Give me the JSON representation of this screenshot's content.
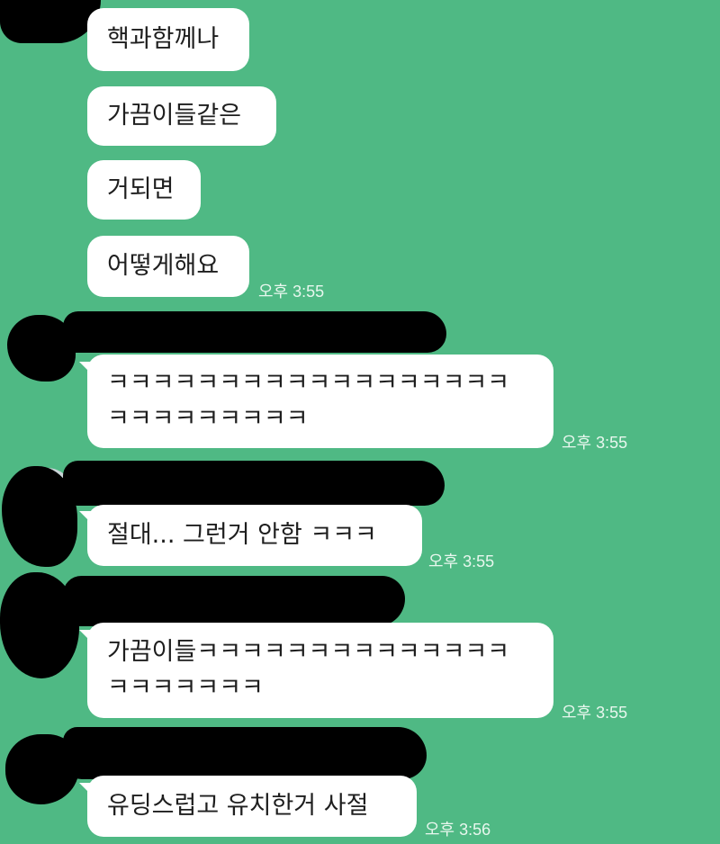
{
  "theme": {
    "background": "#4fb984",
    "bubble_color": "#ffffff",
    "text_color": "#1e1e1e",
    "time_color": "#e8f7ee",
    "redaction_color": "#000000"
  },
  "messages": [
    {
      "text": "핵과함께나"
    },
    {
      "text": "가끔이들같은"
    },
    {
      "text": "거되면"
    },
    {
      "text": "어떻게해요",
      "time": "오후 3:55"
    },
    {
      "lines": [
        "ㅋㅋㅋㅋㅋㅋㅋㅋㅋㅋㅋㅋㅋㅋㅋㅋㅋㅋ",
        "ㅋㅋㅋㅋㅋㅋㅋㅋㅋ"
      ],
      "time": "오후 3:55"
    },
    {
      "text": "절대... 그런거 안함 ㅋㅋㅋ",
      "time": "오후 3:55"
    },
    {
      "lines": [
        "가끔이들ㅋㅋㅋㅋㅋㅋㅋㅋㅋㅋㅋㅋㅋㅋ",
        "ㅋㅋㅋㅋㅋㅋㅋ"
      ],
      "time": "오후 3:55"
    },
    {
      "text": "유딩스럽고 유치한거 사절",
      "time": "오후 3:56"
    }
  ]
}
